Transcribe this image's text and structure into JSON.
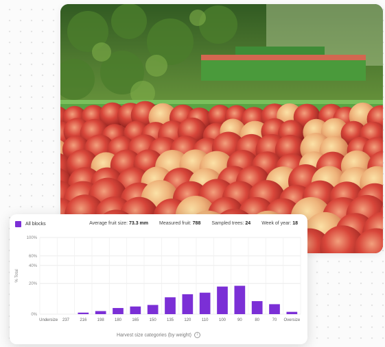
{
  "legend": {
    "label": "All blocks",
    "color": "#7b2fd6"
  },
  "stats": {
    "avg_fruit_label": "Average fruit size:",
    "avg_fruit_value": "73.3 mm",
    "measured_label": "Measured fruit:",
    "measured_value": "788",
    "sampled_label": "Sampled trees:",
    "sampled_value": "24",
    "week_label": "Week of year:",
    "week_value": "18"
  },
  "chart_data": {
    "type": "bar",
    "categories": [
      "Undersize",
      "237",
      "216",
      "198",
      "180",
      "165",
      "150",
      "135",
      "120",
      "110",
      "100",
      "90",
      "80",
      "70",
      "Oversize"
    ],
    "values": [
      0,
      0,
      1,
      2,
      4,
      5,
      6,
      11,
      13,
      14,
      18,
      18.5,
      8.5,
      6.5,
      1.5
    ],
    "ylabel": "% Total",
    "xlabel": "Harvest size categories (by weight)",
    "ytick_labels": [
      "0%",
      "20%",
      "40%",
      "60%",
      "100%"
    ],
    "yticks": [
      0,
      20,
      40,
      60,
      100
    ],
    "ylim": [
      0,
      100
    ],
    "bar_color": "#7b2fd6",
    "grid": true
  }
}
